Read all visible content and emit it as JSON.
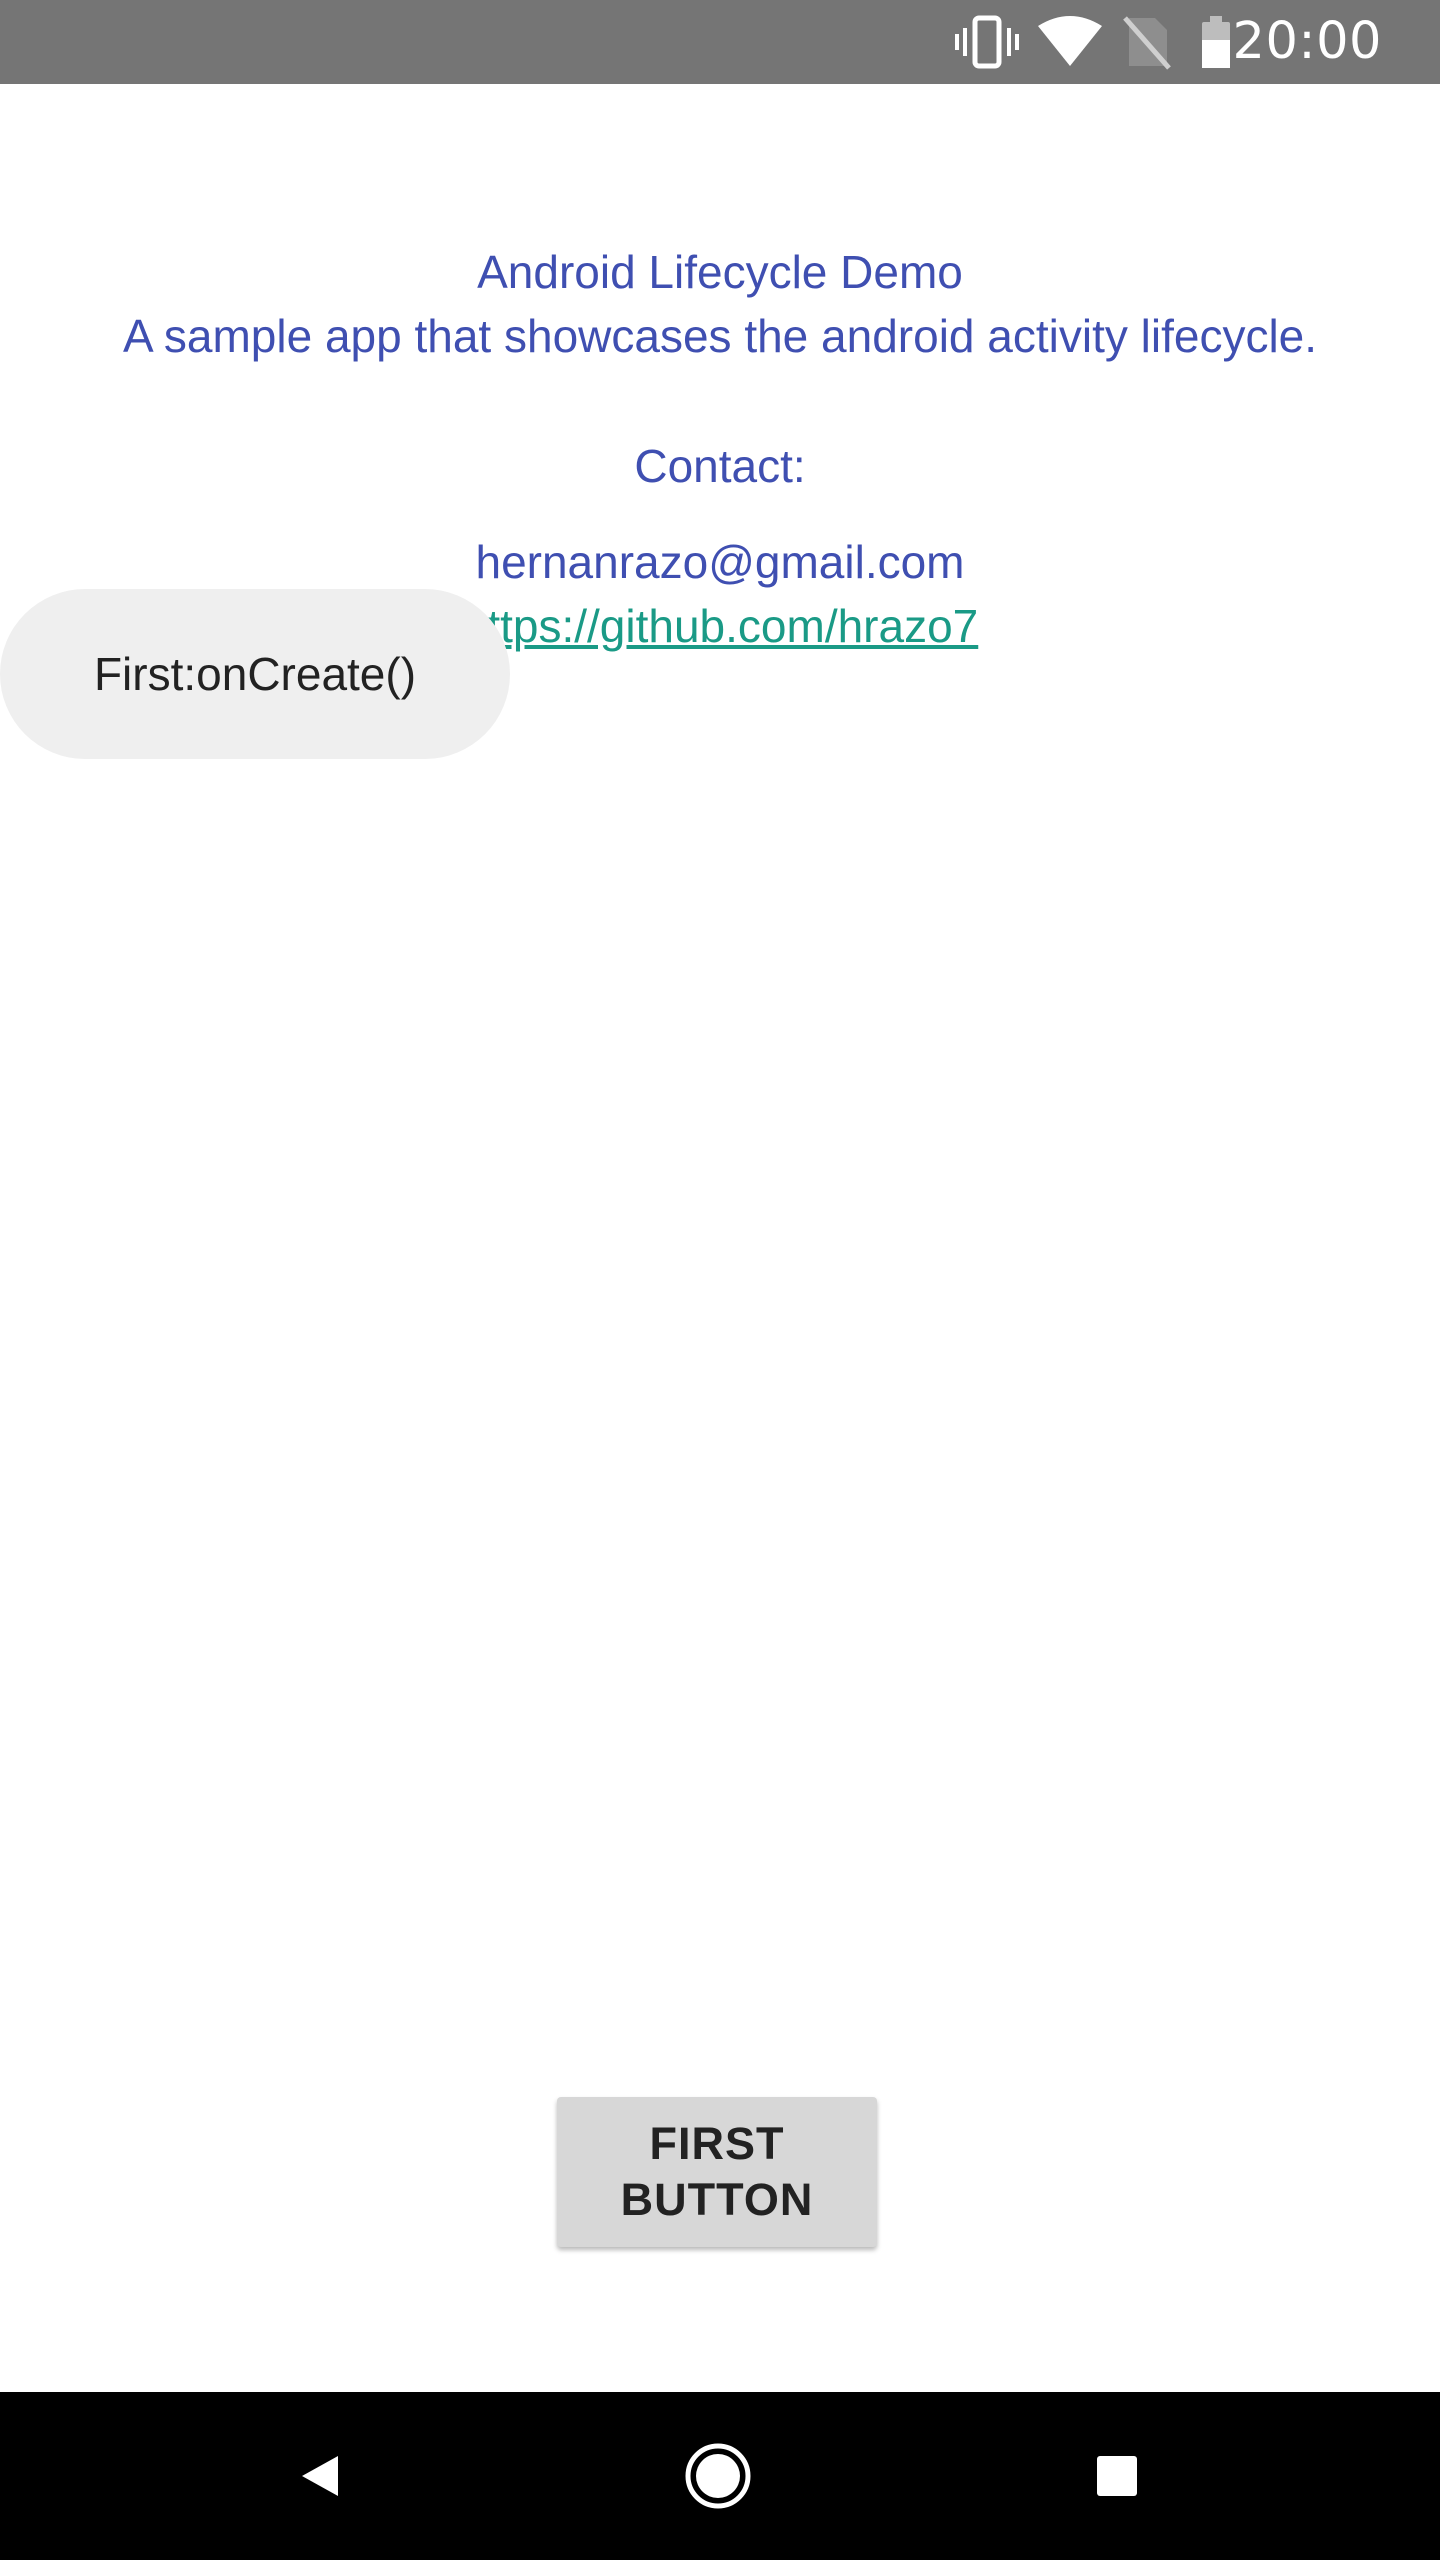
{
  "status_bar": {
    "time": "20:00",
    "icons": [
      "vibrate-icon",
      "wifi-icon",
      "no-sim-icon",
      "battery-icon"
    ]
  },
  "app": {
    "title": "Android Lifecycle Demo",
    "description": "A sample app that showcases the android activity lifecycle.",
    "contact_label": "Contact:",
    "email": "hernanrazo@gmail.com",
    "github_url": "https://github.com/hrazo7"
  },
  "toast": {
    "text": "First:onCreate()"
  },
  "button": {
    "line1": "FIRST",
    "line2": "BUTTON"
  },
  "nav_bar": {
    "icons": [
      "back-icon",
      "home-icon",
      "recents-icon"
    ]
  },
  "colors": {
    "status_bar": "#757575",
    "info_text": "#3f4fb1",
    "link_text": "#1a9a86",
    "toast_bg": "#efefef",
    "button_bg": "#d7d7d7",
    "nav_bar": "#000000"
  }
}
